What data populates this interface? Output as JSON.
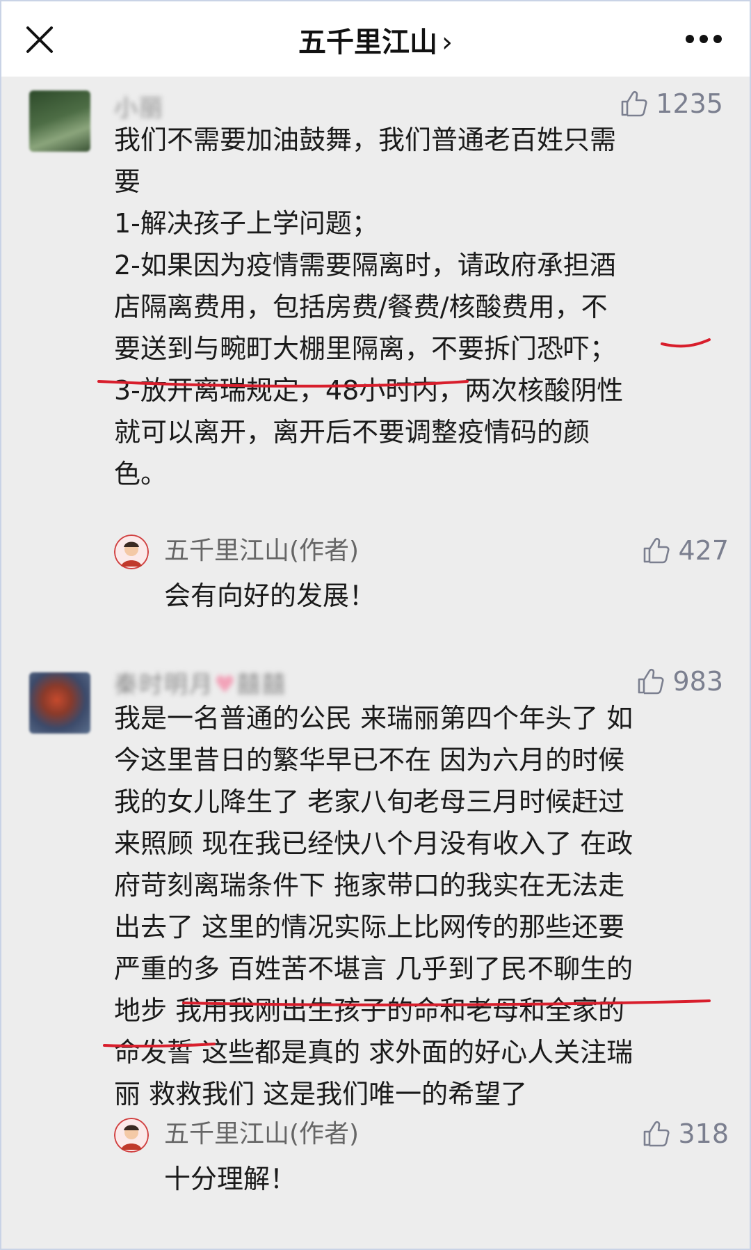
{
  "header": {
    "title": "五千里江山",
    "chevron": "›",
    "close_icon": "close-icon",
    "more_icon": "more-dots-icon"
  },
  "comments": [
    {
      "user_name": "小丽",
      "likes": "1235",
      "lines": [
        "我们不需要加油鼓舞，我们普通老百姓只需",
        "要",
        "1-解决孩子上学问题；",
        "2-如果因为疫情需要隔离时，请政府承担酒",
        "店隔离费用，包括房费/餐费/核酸费用，不",
        "要送到与畹町大棚里隔离，不要拆门恐吓；",
        "3-放开离瑞规定，48小时内，两次核酸阴性",
        "就可以离开，离开后不要调整疫情码的颜",
        "色。"
      ],
      "reply": {
        "author": "五千里江山(作者)",
        "text": "会有向好的发展！",
        "likes": "427"
      }
    },
    {
      "user_name": "秦时明月",
      "user_name_suffix": "囍囍",
      "likes": "983",
      "lines": [
        "我是一名普通的公民 来瑞丽第四个年头了 如",
        "今这里昔日的繁华早已不在 因为六月的时候",
        "我的女儿降生了 老家八旬老母三月时候赶过",
        "来照顾 现在我已经快八个月没有收入了 在政",
        "府苛刻离瑞条件下 拖家带口的我实在无法走",
        "出去了 这里的情况实际上比网传的那些还要",
        "严重的多 百姓苦不堪言 几乎到了民不聊生的",
        "地步 我用我刚出生孩子的命和老母和全家的",
        "命发誓 这些都是真的 求外面的好心人关注瑞",
        "丽 救救我们 这是我们唯一的希望了"
      ],
      "reply": {
        "author": "五千里江山(作者)",
        "text": "十分理解！",
        "likes": "318"
      }
    }
  ],
  "colors": {
    "background": "#ededed",
    "header": "#ffffff",
    "underline": "#d81e2c",
    "meta_gray": "#7b7f8f"
  }
}
